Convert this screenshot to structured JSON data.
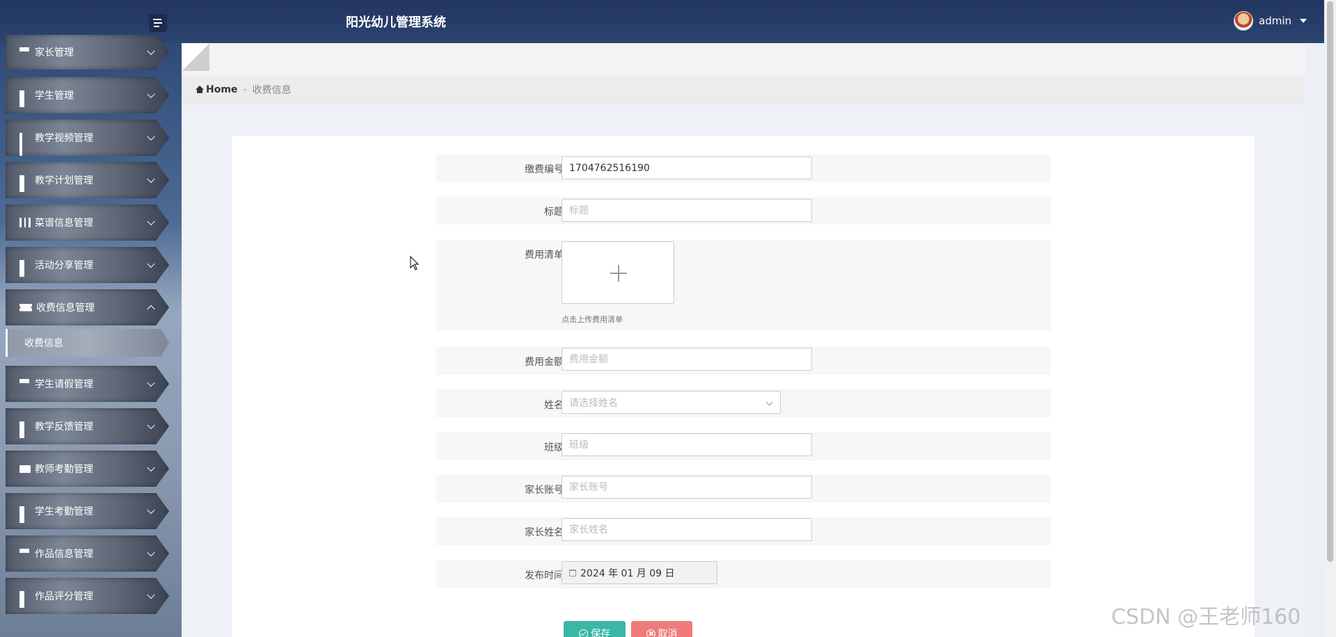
{
  "header": {
    "app_title": "阳光幼儿管理系统",
    "username": "admin"
  },
  "sidebar": {
    "items": [
      {
        "label": "家长管理",
        "icon": "list-icon"
      },
      {
        "label": "学生管理",
        "icon": "grid-icon"
      },
      {
        "label": "教学视频管理",
        "icon": "grid9-icon"
      },
      {
        "label": "教学计划管理",
        "icon": "grid-icon"
      },
      {
        "label": "菜谱信息管理",
        "icon": "book-icon"
      },
      {
        "label": "活动分享管理",
        "icon": "grid-icon"
      },
      {
        "label": "收费信息管理",
        "icon": "ticket-icon",
        "expanded": true
      },
      {
        "label": "学生请假管理",
        "icon": "sliders-icon"
      },
      {
        "label": "教学反馈管理",
        "icon": "grid-icon"
      },
      {
        "label": "教师考勤管理",
        "icon": "briefcase-icon"
      },
      {
        "label": "学生考勤管理",
        "icon": "grid-icon"
      },
      {
        "label": "作品信息管理",
        "icon": "list-icon"
      },
      {
        "label": "作品评分管理",
        "icon": "grid-icon"
      }
    ],
    "submenu": {
      "label": "收费信息"
    }
  },
  "breadcrumb": {
    "home": "Home",
    "separator": "-",
    "current": "收费信息"
  },
  "form": {
    "payment_no": {
      "label": "缴费编号",
      "value": "1704762516190"
    },
    "title": {
      "label": "标题",
      "placeholder": "标题"
    },
    "fee_list": {
      "label": "费用清单",
      "hint": "点击上传费用清单"
    },
    "amount": {
      "label": "费用金额",
      "placeholder": "费用金额"
    },
    "name": {
      "label": "姓名",
      "placeholder": "请选择姓名"
    },
    "class": {
      "label": "班级",
      "placeholder": "班级"
    },
    "parent_account": {
      "label": "家长账号",
      "placeholder": "家长账号"
    },
    "parent_name": {
      "label": "家长姓名",
      "placeholder": "家长姓名"
    },
    "publish_time": {
      "label": "发布时间",
      "value": "2024 年 01 月 09 日"
    }
  },
  "buttons": {
    "save": "保存",
    "cancel": "取消"
  },
  "watermark": "CSDN @王老师160",
  "colors": {
    "header_bg": "#21355f",
    "save_button": "#3cb6a5",
    "cancel_button": "#ef7a7a"
  }
}
